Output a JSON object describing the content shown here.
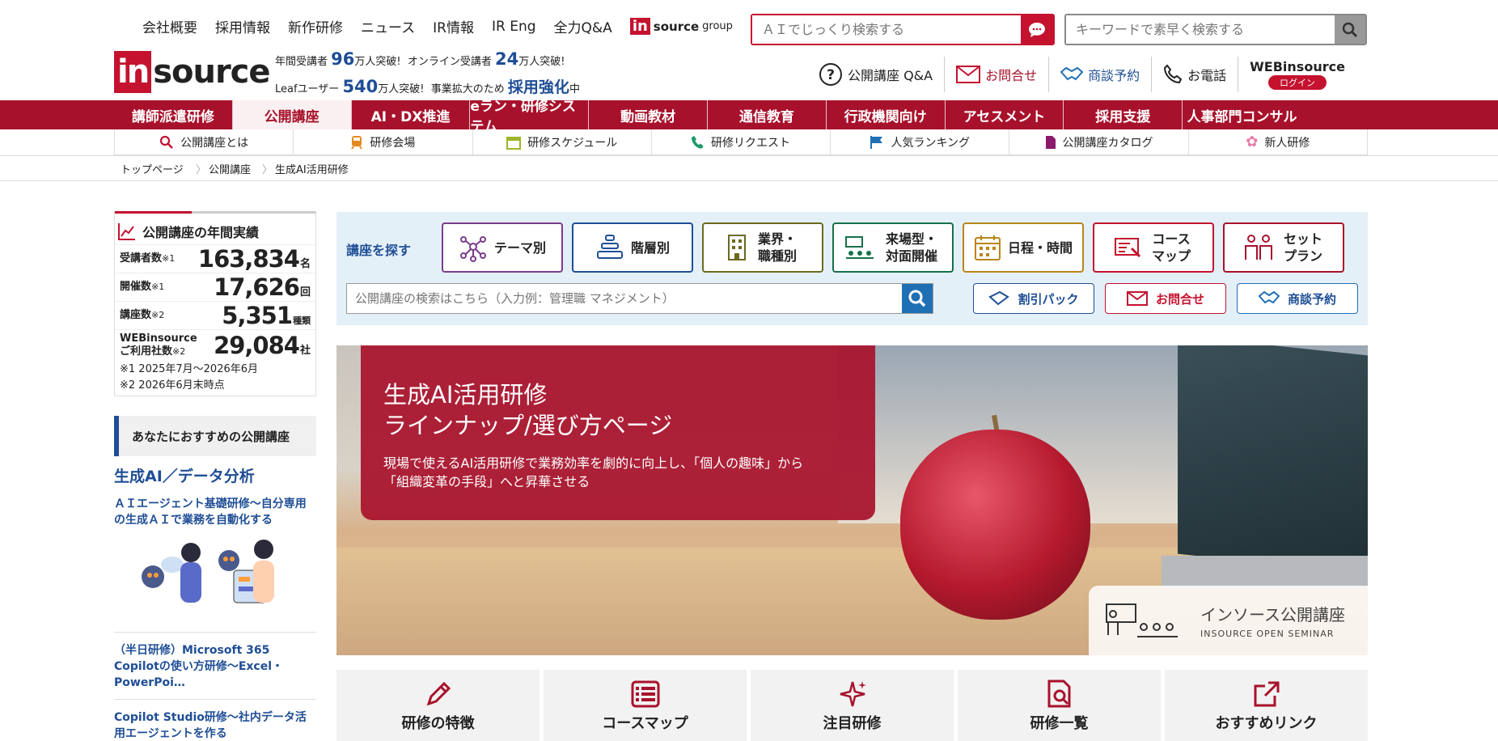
{
  "header": {
    "top_links": [
      "会社概要",
      "採用情報",
      "新作研修",
      "ニュース",
      "IR情報",
      "IR Eng",
      "全力Q&A"
    ],
    "group_logo": {
      "in": "in",
      "rest": "source",
      "suffix": "group"
    },
    "ai_search_placeholder": "ＡＩでじっくり検索する",
    "keyword_search_placeholder": "キーワードで素早く検索する",
    "logo": {
      "in": "in",
      "rest": "source"
    },
    "stats": {
      "line1_a": "年間受講者",
      "line1_a_num": "96",
      "line1_a_unit": "万人突破!",
      "line1_b": "オンライン受講者",
      "line1_b_num": "24",
      "line1_b_unit": "万人突破!",
      "line2_a": "Leafユーザー",
      "line2_a_num": "540",
      "line2_a_unit": "万人突破!",
      "line2_b": "事業拡大のため",
      "line2_b_em": "採用強化",
      "line2_b_unit": "中"
    },
    "utility": {
      "qa": "公開講座 Q&A",
      "contact": "お問合せ",
      "consult": "商談予約",
      "phone": "お電話",
      "web_title": "WEBinsource",
      "web_login": "ログイン"
    }
  },
  "main_nav": [
    "講師派遣研修",
    "公開講座",
    "AI・DX推進",
    "eラン・研修システム",
    "動画教材",
    "通信教育",
    "行政機関向け",
    "アセスメント",
    "採用支援",
    "人事部門コンサル"
  ],
  "sub_nav": [
    "公開講座とは",
    "研修会場",
    "研修スケジュール",
    "研修リクエスト",
    "人気ランキング",
    "公開講座カタログ",
    "新人研修"
  ],
  "breadcrumb": [
    "トップページ",
    "公開講座",
    "生成AI活用研修"
  ],
  "sidebar": {
    "annual_title": "公開講座の年間実績",
    "rows": [
      {
        "label": "受講者数",
        "mark": "※1",
        "value": "163,834",
        "unit": "名"
      },
      {
        "label": "開催数",
        "mark": "※1",
        "value": "17,626",
        "unit": "回"
      },
      {
        "label": "講座数",
        "mark": "※2",
        "value": "5,351",
        "unit": "種類"
      },
      {
        "label": "WEBinsource ご利用社数",
        "mark": "※2",
        "value": "29,084",
        "unit": "社"
      }
    ],
    "notes": [
      "※1 2025年7月〜2026年6月",
      "※2 2026年6月末時点"
    ],
    "reco_title": "あなたにおすすめの公開講座",
    "reco_category": "生成AI／データ分析",
    "reco_links": [
      "ＡＩエージェント基礎研修～自分専用の生成ＡＩで業務を自動化する",
      "（半日研修）Microsoft 365 Copilotの使い方研修～Excel・PowerPoi…",
      "Copilot Studio研修～社内データ活用エージェントを作る"
    ]
  },
  "finder": {
    "label": "講座を探す",
    "buttons": [
      {
        "text": "テーマ別",
        "color": "#7b3c8c"
      },
      {
        "text": "階層別",
        "color": "#1f4e96"
      },
      {
        "text": "業界・職種別",
        "color": "#6b6a1e"
      },
      {
        "text": "来場型・対面開催",
        "color": "#17704a"
      },
      {
        "text": "日程・時間",
        "color": "#b8861b"
      },
      {
        "text": "コースマップ",
        "color": "#c4122f"
      },
      {
        "text": "セットプラン",
        "color": "#a8112b"
      }
    ],
    "search_placeholder": "公開講座の検索はこちら（入力例：管理職 マネジメント）",
    "discount": "割引パック",
    "contact": "お問合せ",
    "consult": "商談予約"
  },
  "hero": {
    "title_line1": "生成AI活用研修",
    "title_line2": "ラインナップ/選び方ページ",
    "desc_line1": "現場で使えるAI活用研修で業務効率を劇的に向上し、「個人の趣味」から",
    "desc_line2": "「組織変革の手段」へと昇華させる",
    "badge_title": "インソース公開講座",
    "badge_sub": "INSOURCE OPEN SEMINAR"
  },
  "tiles": [
    "研修の特徴",
    "コースマップ",
    "注目研修",
    "研修一覧",
    "おすすめリンク"
  ],
  "colors": {
    "brand_red": "#a8112b",
    "brand_blue": "#1f4e96",
    "accent_red": "#c4122f"
  }
}
